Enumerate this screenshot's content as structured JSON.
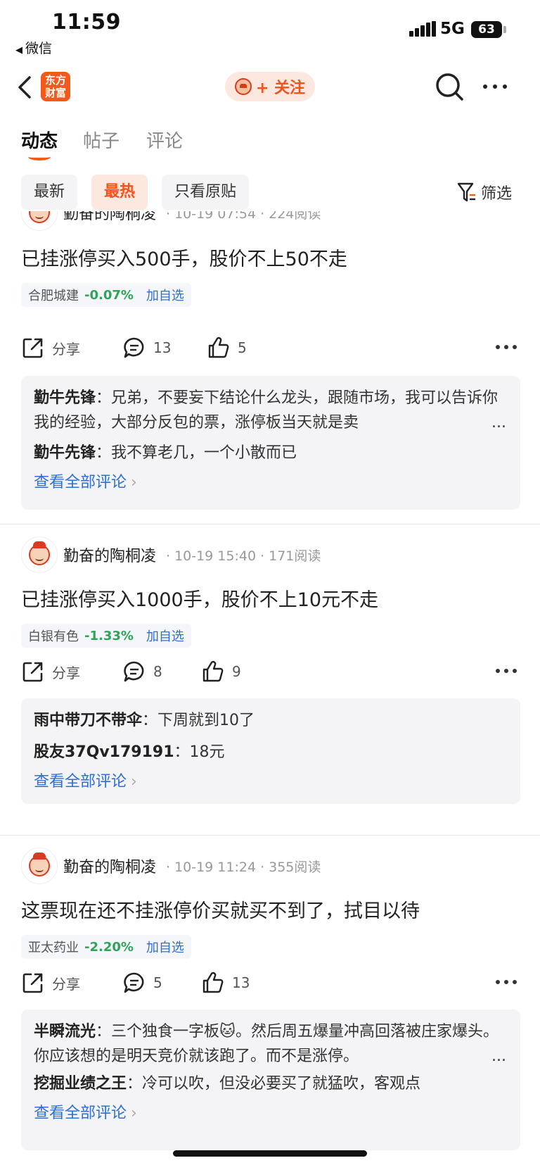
{
  "status_bar": {
    "time": "11:59",
    "back_app": "微信",
    "network": "5G",
    "battery": "63"
  },
  "nav": {
    "logo_text": "东方财富",
    "follow_label": "+ 关注"
  },
  "tabs": [
    {
      "label": "动态",
      "active": true
    },
    {
      "label": "帖子",
      "active": false
    },
    {
      "label": "评论",
      "active": false
    }
  ],
  "filters": {
    "chips": [
      {
        "label": "最新",
        "active": false
      },
      {
        "label": "最热",
        "active": true
      },
      {
        "label": "只看原贴",
        "active": false
      }
    ],
    "filter_label": "筛选"
  },
  "posts": [
    {
      "author": "勤奋的陶桐凌",
      "date": "10-19 07:54",
      "reads": "224阅读",
      "title": "已挂涨停买入500手，股价不上50不走",
      "stock": {
        "name": "合肥城建",
        "change": "-0.07%",
        "add_label": "加自选"
      },
      "share_label": "分享",
      "comment_count": "13",
      "like_count": "5",
      "comments": [
        {
          "name": "勤牛先锋",
          "text": "兄弟，不要妄下结论什么龙头，跟随市场，我可以告诉你我的经验，大部分反包的票，涨停板当天就是卖",
          "truncated": "..."
        },
        {
          "name": "勤牛先锋",
          "text": "我不算老几，一个小散而已",
          "truncated": ""
        }
      ],
      "view_all": "查看全部评论"
    },
    {
      "author": "勤奋的陶桐凌",
      "date": "10-19 15:40",
      "reads": "171阅读",
      "title": "已挂涨停买入1000手，股价不上10元不走",
      "stock": {
        "name": "白银有色",
        "change": "-1.33%",
        "add_label": "加自选"
      },
      "share_label": "分享",
      "comment_count": "8",
      "like_count": "9",
      "comments": [
        {
          "name": "雨中带刀不带伞",
          "text": "下周就到10了",
          "truncated": ""
        },
        {
          "name": "股友37Qv179191",
          "text": "18元",
          "truncated": ""
        }
      ],
      "view_all": "查看全部评论"
    },
    {
      "author": "勤奋的陶桐凌",
      "date": "10-19 11:24",
      "reads": "355阅读",
      "title": "这票现在还不挂涨停价买就买不到了，拭目以待",
      "stock": {
        "name": "亚太药业",
        "change": "-2.20%",
        "add_label": "加自选"
      },
      "share_label": "分享",
      "comment_count": "5",
      "like_count": "13",
      "comments": [
        {
          "name": "半瞬流光",
          "text": "三个独食一字板🐱。然后周五爆量冲高回落被庄家爆头。你应该想的是明天竞价就该跑了。而不是涨停。",
          "truncated": "..."
        },
        {
          "name": "挖掘业绩之王",
          "text": "冷可以吹，但没必要买了就猛吹，客观点",
          "truncated": ""
        }
      ],
      "view_all": "查看全部评论"
    }
  ]
}
